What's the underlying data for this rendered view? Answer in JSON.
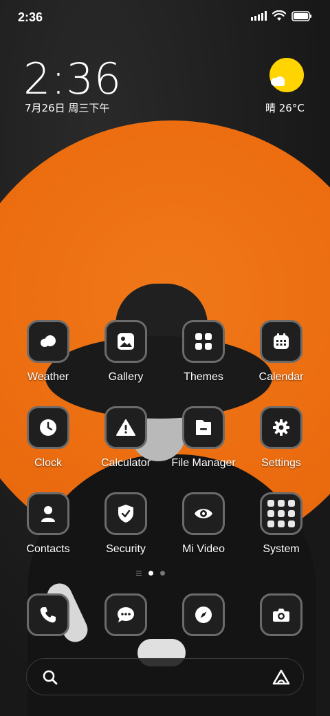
{
  "status_bar": {
    "time": "2:36"
  },
  "clock_widget": {
    "time": "2:36",
    "date": "7月26日 周三下午"
  },
  "weather_widget": {
    "text": "晴 26°C"
  },
  "apps": [
    {
      "label": "Weather"
    },
    {
      "label": "Gallery"
    },
    {
      "label": "Themes"
    },
    {
      "label": "Calendar"
    },
    {
      "label": "Clock"
    },
    {
      "label": "Calculator"
    },
    {
      "label": "File Manager"
    },
    {
      "label": "Settings"
    },
    {
      "label": "Contacts"
    },
    {
      "label": "Security"
    },
    {
      "label": "Mi Video"
    },
    {
      "label": "System"
    }
  ],
  "page_indicator": {
    "pages": 2,
    "current": 1
  },
  "dock": [
    "phone-icon",
    "messages-icon",
    "browser-icon",
    "camera-icon"
  ],
  "colors": {
    "accent_orange": "#ea6a0e",
    "weather_sun": "#ffd400"
  }
}
